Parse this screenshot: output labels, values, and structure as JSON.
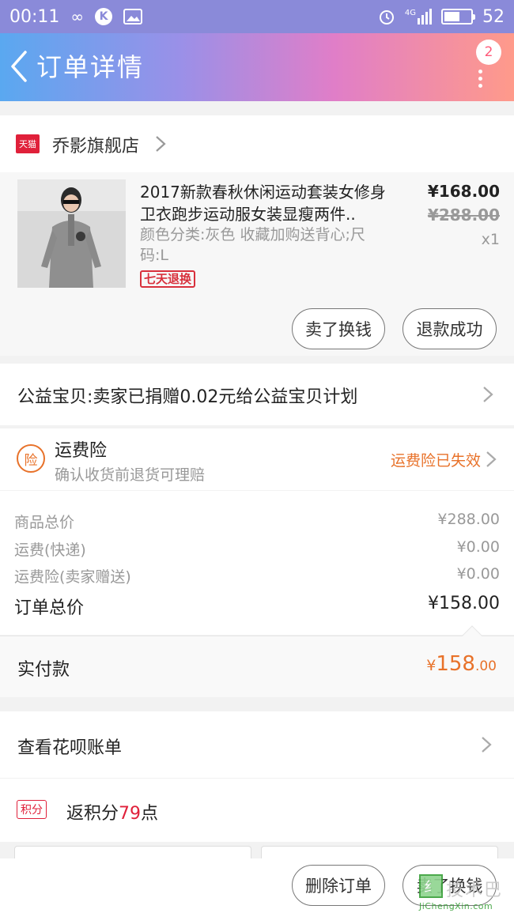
{
  "status_bar": {
    "time": "00:11",
    "infinity_icon": "infinity-icon",
    "k_label": "K",
    "signal_label": "4G",
    "battery_level": "52"
  },
  "nav": {
    "title": "订单详情",
    "badge_count": "2"
  },
  "shop": {
    "tmall_label": "天猫",
    "name": "乔影旗舰店"
  },
  "product": {
    "title": "2017新款春秋休闲运动套装女修身卫衣跑步运动服女装显瘦两件..",
    "spec": "颜色分类:灰色 收藏加购送背心;尺码:L",
    "tag": "七天退换",
    "price_now": "¥168.00",
    "price_old": "¥288.00",
    "qty": "x1",
    "btn_sell": "卖了换钱",
    "btn_refund": "退款成功"
  },
  "charity": {
    "text": "公益宝贝:卖家已捐赠0.02元给公益宝贝计划"
  },
  "insurance": {
    "icon_label": "险",
    "title": "运费险",
    "subtitle": "确认收货前退货可理赔",
    "status": "运费险已失效"
  },
  "prices": {
    "rows": [
      {
        "label": "商品总价",
        "value": "¥288.00"
      },
      {
        "label": "运费(快递)",
        "value": "¥0.00"
      },
      {
        "label": "运费险(卖家赠送)",
        "value": "¥0.00"
      }
    ],
    "total_label": "订单总价",
    "total_value": "¥158.00"
  },
  "paid": {
    "label": "实付款",
    "currency": "¥",
    "integer": "158",
    "decimal": ".00"
  },
  "huabei": {
    "text": "查看花呗账单"
  },
  "points": {
    "tag": "积分",
    "prefix": "返积分",
    "value": "79",
    "suffix": "点"
  },
  "bottom": {
    "delete_btn": "删除订单",
    "sell_btn": "卖了换钱"
  },
  "watermark": {
    "box_char": "纟",
    "text": "技术巴",
    "sub": "JiChengXin.com"
  },
  "colors": {
    "accent_orange": "#e8722a",
    "accent_red": "#e0203a",
    "statusbar_bg": "#8a8ad9"
  }
}
